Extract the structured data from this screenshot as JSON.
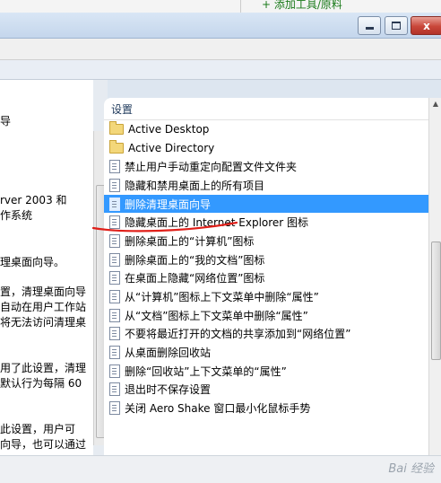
{
  "topbar": {
    "left_text": "",
    "right_text": "+ 添加工具/原料"
  },
  "window": {
    "minimize": "",
    "maximize": "",
    "close": "x"
  },
  "description": {
    "lines": [
      "导",
      "rver 2003 和",
      "作系统",
      "理桌面向导。",
      "置，清理桌面向导",
      "自动在用户工作站",
      "将无法访问清理桌",
      "用了此设置，清理",
      "默认行为每隔 60",
      "此设置，用户可",
      "向导，也可以通过"
    ]
  },
  "settings": {
    "header": "设置",
    "items": [
      {
        "label": "Active Desktop",
        "type": "folder"
      },
      {
        "label": "Active Directory",
        "type": "folder"
      },
      {
        "label": "禁止用户手动重定向配置文件文件夹",
        "type": "setting"
      },
      {
        "label": "隐藏和禁用桌面上的所有项目",
        "type": "setting"
      },
      {
        "label": "删除清理桌面向导",
        "type": "setting",
        "selected": true
      },
      {
        "label": "隐藏桌面上的 Internet Explorer 图标",
        "type": "setting"
      },
      {
        "label": "删除桌面上的“计算机”图标",
        "type": "setting"
      },
      {
        "label": "删除桌面上的“我的文档”图标",
        "type": "setting"
      },
      {
        "label": "在桌面上隐藏“网络位置”图标",
        "type": "setting"
      },
      {
        "label": "从“计算机”图标上下文菜单中删除“属性”",
        "type": "setting"
      },
      {
        "label": "从“文档”图标上下文菜单中删除“属性”",
        "type": "setting"
      },
      {
        "label": "不要将最近打开的文档的共享添加到“网络位置”",
        "type": "setting"
      },
      {
        "label": "从桌面删除回收站",
        "type": "setting"
      },
      {
        "label": "删除“回收站”上下文菜单的“属性”",
        "type": "setting"
      },
      {
        "label": "退出时不保存设置",
        "type": "setting"
      },
      {
        "label": "关闭 Aero Shake 窗口最小化鼠标手势",
        "type": "setting"
      }
    ]
  },
  "watermark": "Bai 经验"
}
